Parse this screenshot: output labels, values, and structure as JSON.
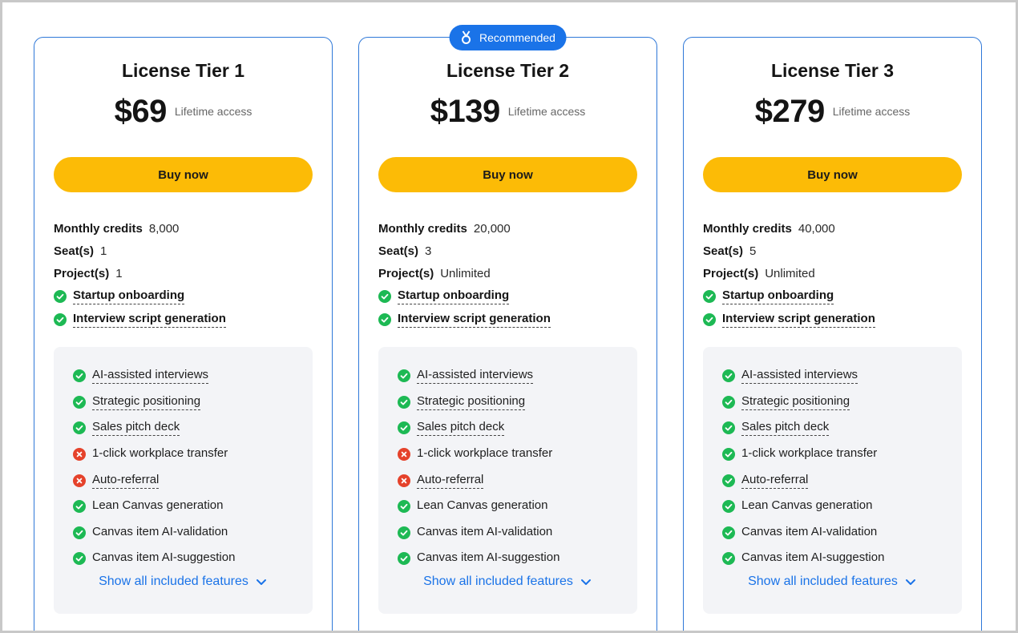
{
  "badge": {
    "label": "Recommended",
    "icon": "medal-icon",
    "color": "#1a73e8"
  },
  "colors": {
    "accent": "#1a73e8",
    "card_border": "#2f78d8",
    "button": "#fcbb06",
    "check": "#1db954",
    "cross": "#e5422b",
    "panel_bg": "#f3f4f7"
  },
  "tiers": [
    {
      "title": "License Tier 1",
      "price": "$69",
      "price_note": "Lifetime access",
      "buy_label": "Buy now",
      "specs": [
        {
          "label": "Monthly credits",
          "value": "8,000"
        },
        {
          "label": "Seat(s)",
          "value": "1"
        },
        {
          "label": "Project(s)",
          "value": "1"
        }
      ],
      "features": [
        {
          "label": "Startup onboarding",
          "included": true
        },
        {
          "label": "Interview script generation",
          "included": true
        }
      ],
      "panel_features": [
        {
          "label": "AI-assisted interviews",
          "included": true,
          "underline": true
        },
        {
          "label": "Strategic positioning",
          "included": true,
          "underline": true
        },
        {
          "label": "Sales pitch deck",
          "included": true,
          "underline": true
        },
        {
          "label": "1-click workplace transfer",
          "included": false,
          "underline": false
        },
        {
          "label": "Auto-referral",
          "included": false,
          "underline": true
        },
        {
          "label": "Lean Canvas generation",
          "included": true,
          "underline": false
        },
        {
          "label": "Canvas item AI-validation",
          "included": true,
          "underline": false
        },
        {
          "label": "Canvas item AI-suggestion",
          "included": true,
          "underline": false
        }
      ],
      "show_all": "Show all included features"
    },
    {
      "title": "License Tier 2",
      "price": "$139",
      "price_note": "Lifetime access",
      "buy_label": "Buy now",
      "recommended": true,
      "specs": [
        {
          "label": "Monthly credits",
          "value": "20,000"
        },
        {
          "label": "Seat(s)",
          "value": "3"
        },
        {
          "label": "Project(s)",
          "value": "Unlimited"
        }
      ],
      "features": [
        {
          "label": "Startup onboarding",
          "included": true
        },
        {
          "label": "Interview script generation",
          "included": true
        }
      ],
      "panel_features": [
        {
          "label": "AI-assisted interviews",
          "included": true,
          "underline": true
        },
        {
          "label": "Strategic positioning",
          "included": true,
          "underline": true
        },
        {
          "label": "Sales pitch deck",
          "included": true,
          "underline": true
        },
        {
          "label": "1-click workplace transfer",
          "included": false,
          "underline": false
        },
        {
          "label": "Auto-referral",
          "included": false,
          "underline": true
        },
        {
          "label": "Lean Canvas generation",
          "included": true,
          "underline": false
        },
        {
          "label": "Canvas item AI-validation",
          "included": true,
          "underline": false
        },
        {
          "label": "Canvas item AI-suggestion",
          "included": true,
          "underline": false
        }
      ],
      "show_all": "Show all included features"
    },
    {
      "title": "License Tier 3",
      "price": "$279",
      "price_note": "Lifetime access",
      "buy_label": "Buy now",
      "specs": [
        {
          "label": "Monthly credits",
          "value": "40,000"
        },
        {
          "label": "Seat(s)",
          "value": "5"
        },
        {
          "label": "Project(s)",
          "value": "Unlimited"
        }
      ],
      "features": [
        {
          "label": "Startup onboarding",
          "included": true
        },
        {
          "label": "Interview script generation",
          "included": true
        }
      ],
      "panel_features": [
        {
          "label": "AI-assisted interviews",
          "included": true,
          "underline": true
        },
        {
          "label": "Strategic positioning",
          "included": true,
          "underline": true
        },
        {
          "label": "Sales pitch deck",
          "included": true,
          "underline": true
        },
        {
          "label": "1-click workplace transfer",
          "included": true,
          "underline": false
        },
        {
          "label": "Auto-referral",
          "included": true,
          "underline": true
        },
        {
          "label": "Lean Canvas generation",
          "included": true,
          "underline": false
        },
        {
          "label": "Canvas item AI-validation",
          "included": true,
          "underline": false
        },
        {
          "label": "Canvas item AI-suggestion",
          "included": true,
          "underline": false
        }
      ],
      "show_all": "Show all included features"
    }
  ]
}
